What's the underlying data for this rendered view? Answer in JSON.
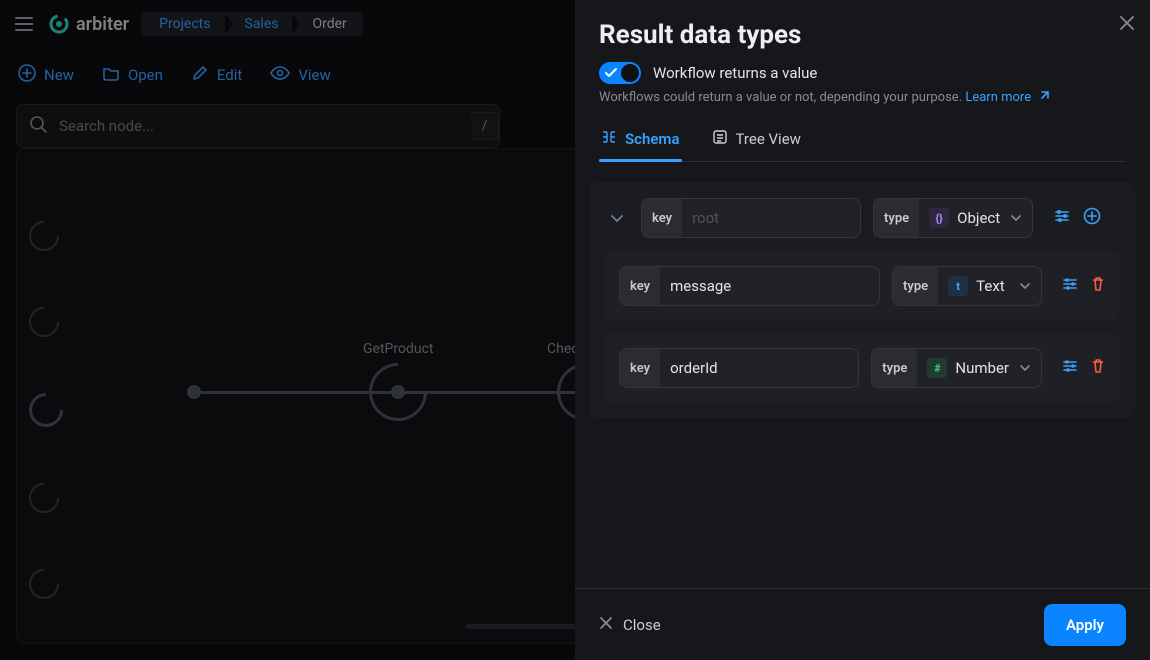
{
  "app": {
    "name": "arbiter"
  },
  "breadcrumb": [
    "Projects",
    "Sales",
    "Order"
  ],
  "toolbar": {
    "new": "New",
    "open": "Open",
    "edit": "Edit",
    "view": "View"
  },
  "search": {
    "placeholder": "Search node...",
    "shortcut": "/"
  },
  "canvas": {
    "nodes": [
      "GetProduct",
      "Chec"
    ]
  },
  "panel": {
    "title": "Result data types",
    "toggle": {
      "label": "Workflow returns a value",
      "on": true
    },
    "subtext": "Workflows could return a value or not, depending your purpose. ",
    "learn": "Learn more",
    "tabs": {
      "schema": "Schema",
      "tree": "Tree View"
    },
    "key_label": "key",
    "type_label": "type",
    "root": {
      "placeholder": "root",
      "type": "Object"
    },
    "children": [
      {
        "key": "message",
        "type": "Text"
      },
      {
        "key": "orderId",
        "type": "Number"
      }
    ],
    "footer": {
      "close": "Close",
      "apply": "Apply"
    }
  }
}
